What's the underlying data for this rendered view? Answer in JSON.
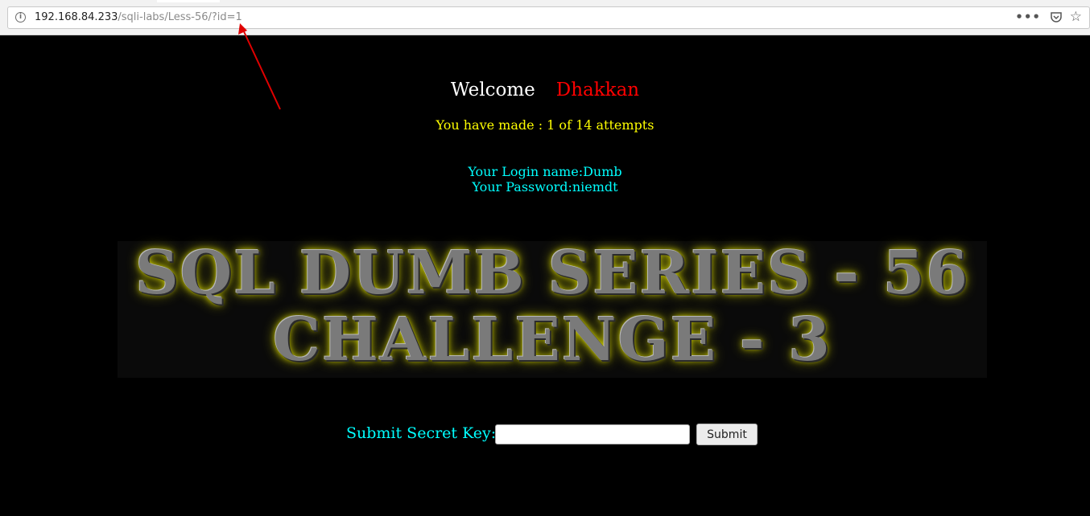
{
  "browser": {
    "url_host": "192.168.84.233",
    "url_path": "/sqli-labs/Less-56/?id=1",
    "icons": [
      "info-icon",
      "page-actions-icon",
      "pocket-icon",
      "bookmark-star-icon"
    ]
  },
  "page": {
    "welcome_label": "Welcome",
    "welcome_name": "Dhakkan",
    "attempts_text": "You have made : 1 of 14 attempts",
    "login_name": "Your Login name:Dumb",
    "password": "Your Password:niemdt",
    "banner_line1": "SQL DUMB SERIES - 56",
    "banner_line2": "CHALLENGE - 3",
    "submit_label": "Submit Secret Key:",
    "secret_key_value": "",
    "submit_button": "Submit"
  },
  "colors": {
    "background": "#000000",
    "welcome": "#ffffff",
    "name": "#ff0000",
    "attempts": "#ffff00",
    "info_text": "#00ffff",
    "annotation_arrow": "#e00000"
  }
}
